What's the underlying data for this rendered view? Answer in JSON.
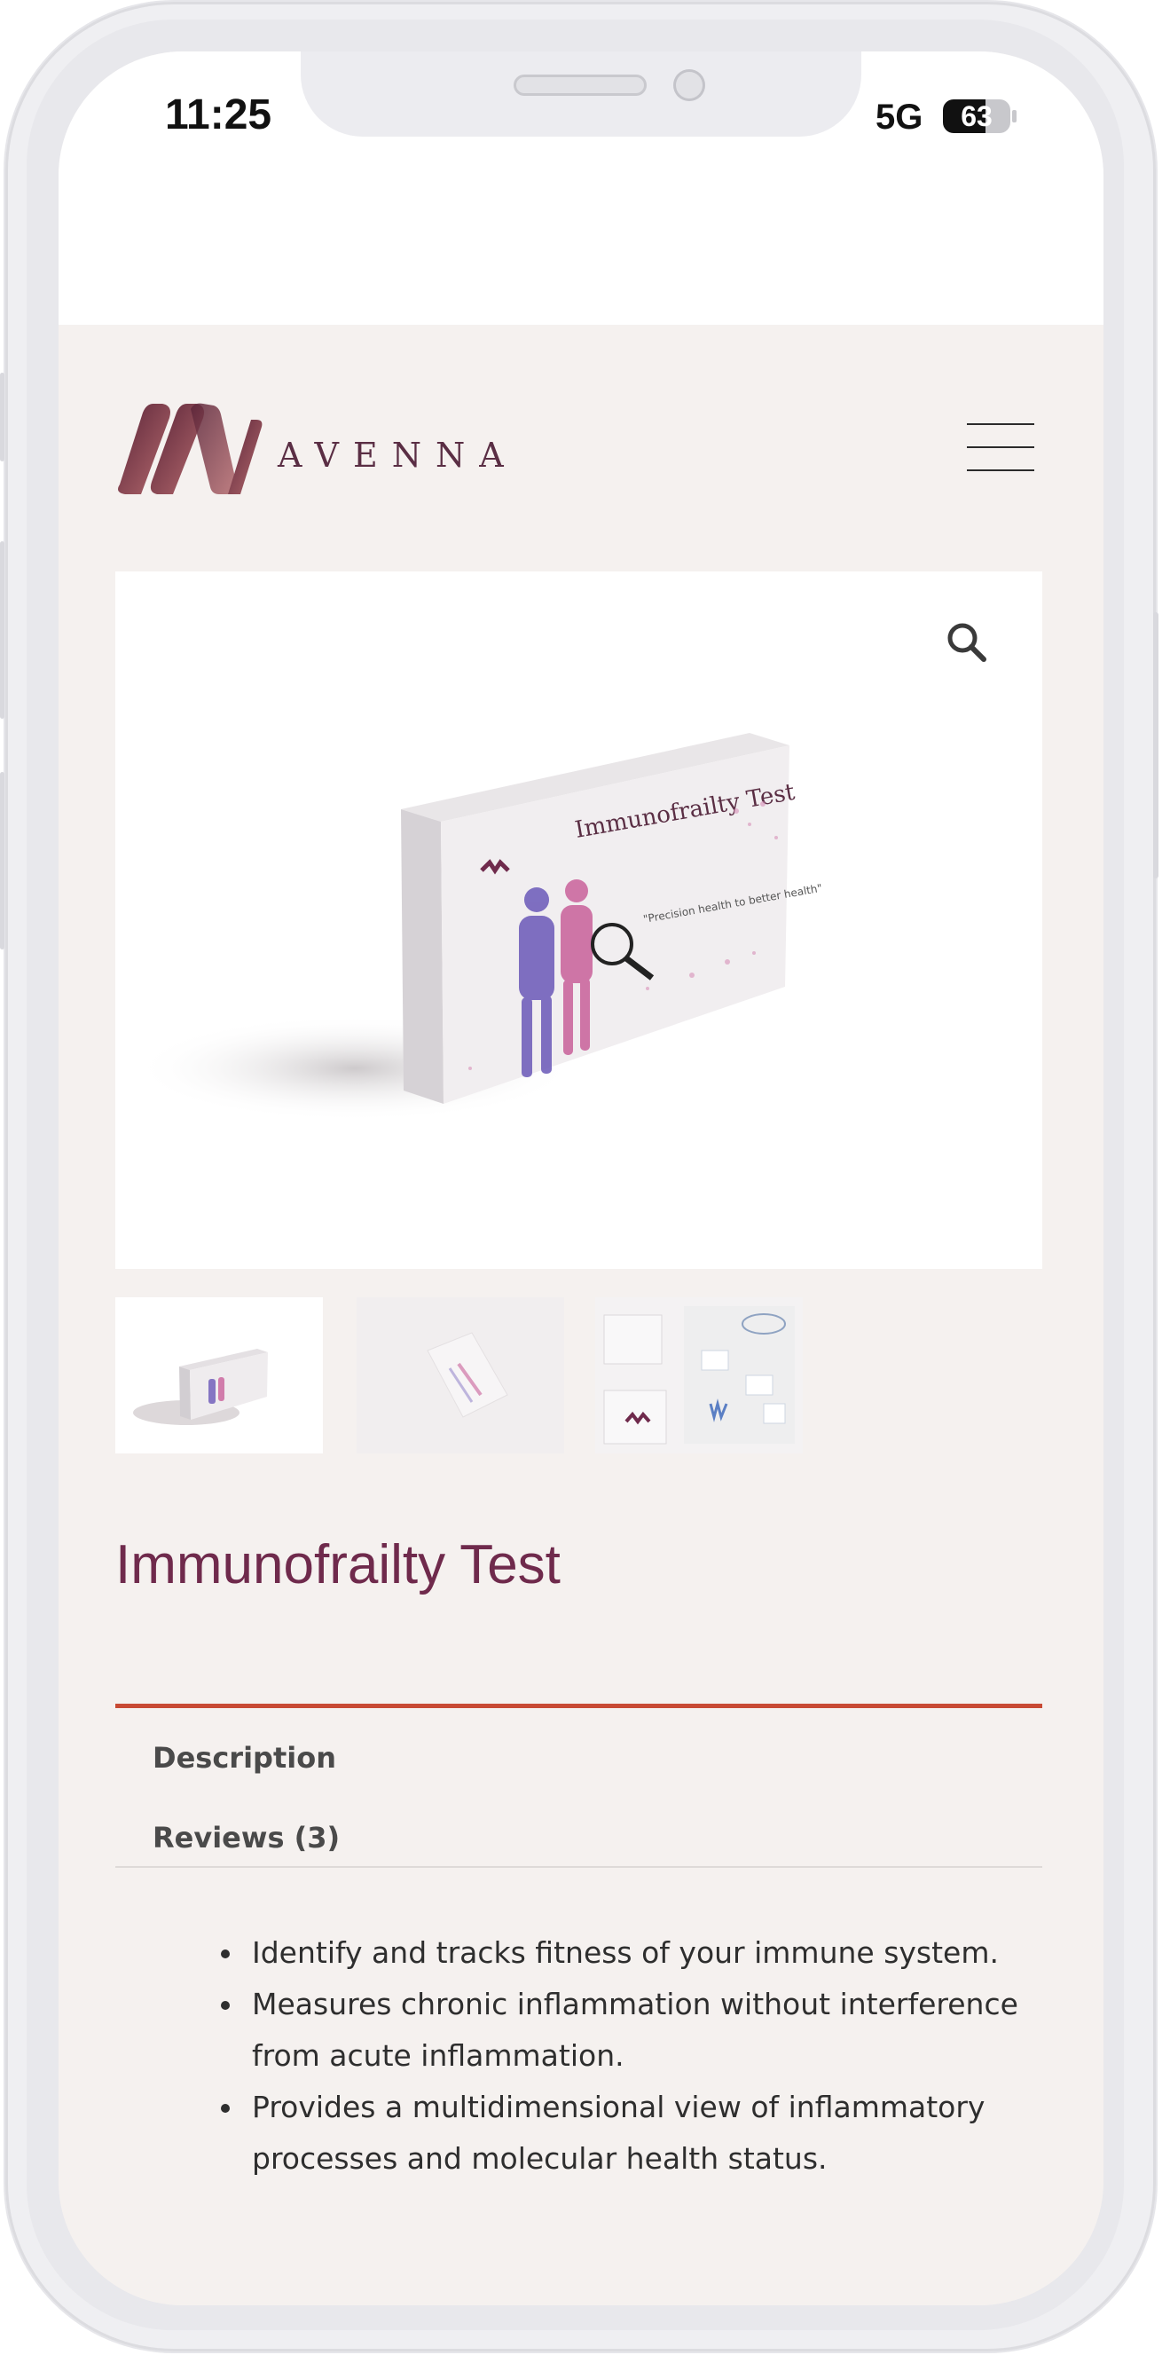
{
  "status_bar": {
    "time": "11:25",
    "network": "5G",
    "battery": "63"
  },
  "site": {
    "brand": "AVENNA",
    "menu_icon": "hamburger-menu-icon",
    "zoom_icon": "search-icon"
  },
  "product": {
    "title": "Immunofrailty Test",
    "package_title": "Immunofrailty Test",
    "package_tagline": "\"Precision health to better health\"",
    "thumbnail_count": 3
  },
  "tabs": [
    {
      "label": "Description",
      "active": true
    },
    {
      "label": "Reviews (3)",
      "active": false
    }
  ],
  "description": {
    "bullets": [
      "Identify and tracks fitness of your immune system.",
      "Measures chronic inflammation without interference from acute inflammation.",
      "Provides a multidimensional view of inflammatory processes and molecular health status."
    ]
  },
  "colors": {
    "brand": "#6f2a4c",
    "accent": "#c84a34",
    "page_bg": "#f5f1ef"
  }
}
